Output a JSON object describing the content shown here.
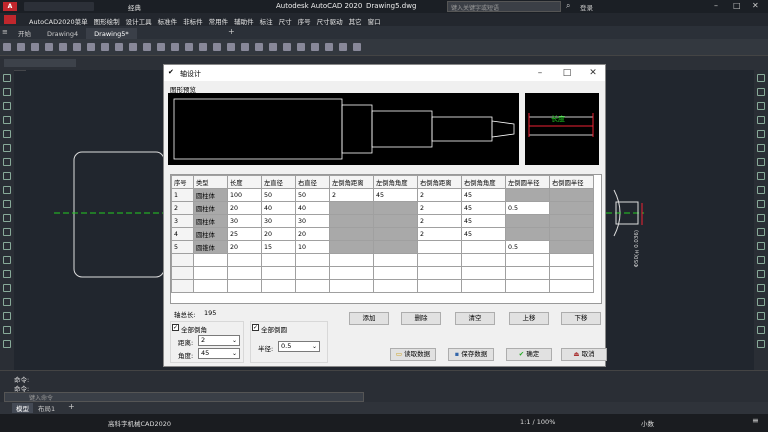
{
  "app": {
    "title": "Autodesk AutoCAD 2020",
    "file": "Drawing5.dwg",
    "workspace": "经典",
    "search_placeholder": "键入关键字或短语",
    "login": "登录"
  },
  "menus": [
    "AutoCAD2020菜单",
    "图形绘制",
    "设计工具",
    "标准件",
    "非标件",
    "常用件",
    "辅助件",
    "标注",
    "尺寸",
    "序号",
    "尺寸驱动",
    "其它",
    "窗口"
  ],
  "doc_tabs": [
    "开始",
    "Drawing4",
    "Drawing5*"
  ],
  "dialog": {
    "title": "轴设计",
    "preview_label": "图形预览",
    "preview2_text": "长度",
    "columns": [
      "序号",
      "类型",
      "长度",
      "左直径",
      "右直径",
      "左倒角距离",
      "左倒角角度",
      "右倒角距离",
      "右倒角角度",
      "左倒圆半径",
      "右倒圆半径"
    ],
    "rows": [
      [
        "1",
        "圆柱体",
        "100",
        "50",
        "50",
        "2",
        "45",
        "2",
        "45",
        "",
        ""
      ],
      [
        "2",
        "圆柱体",
        "20",
        "40",
        "40",
        "",
        "",
        "2",
        "45",
        "0.5",
        ""
      ],
      [
        "3",
        "圆柱体",
        "30",
        "30",
        "30",
        "",
        "",
        "2",
        "45",
        "",
        ""
      ],
      [
        "4",
        "圆柱体",
        "25",
        "20",
        "20",
        "",
        "",
        "2",
        "45",
        "",
        ""
      ],
      [
        "5",
        "圆锥体",
        "20",
        "15",
        "10",
        "",
        "",
        "",
        "",
        "0.5",
        ""
      ]
    ],
    "total_length_label": "轴总长:",
    "total_length": "195",
    "btn_add": "添加",
    "btn_delete": "删除",
    "btn_clear": "清空",
    "btn_up": "上移",
    "btn_down": "下移",
    "chk_chamfer": "全部倒角",
    "chk_fillet": "全部倒圆",
    "distance_label": "距离:",
    "distance_value": "2",
    "angle_label": "角度:",
    "angle_value": "45",
    "radius_label": "半径:",
    "radius_value": "0.5",
    "btn_read": "读取数据",
    "btn_save": "保存数据",
    "btn_ok": "确定",
    "btn_cancel": "取消"
  },
  "command": {
    "line1": "命令:",
    "line2": "命令:",
    "input_placeholder": "键入命令"
  },
  "layout_tabs": [
    "模型",
    "布局1"
  ],
  "statusbar": {
    "app_name": "高科字机械CAD2020",
    "scale": "1:1 / 100%",
    "units": "小数"
  },
  "canvas_dim_text": "Φ50(±0.036)"
}
